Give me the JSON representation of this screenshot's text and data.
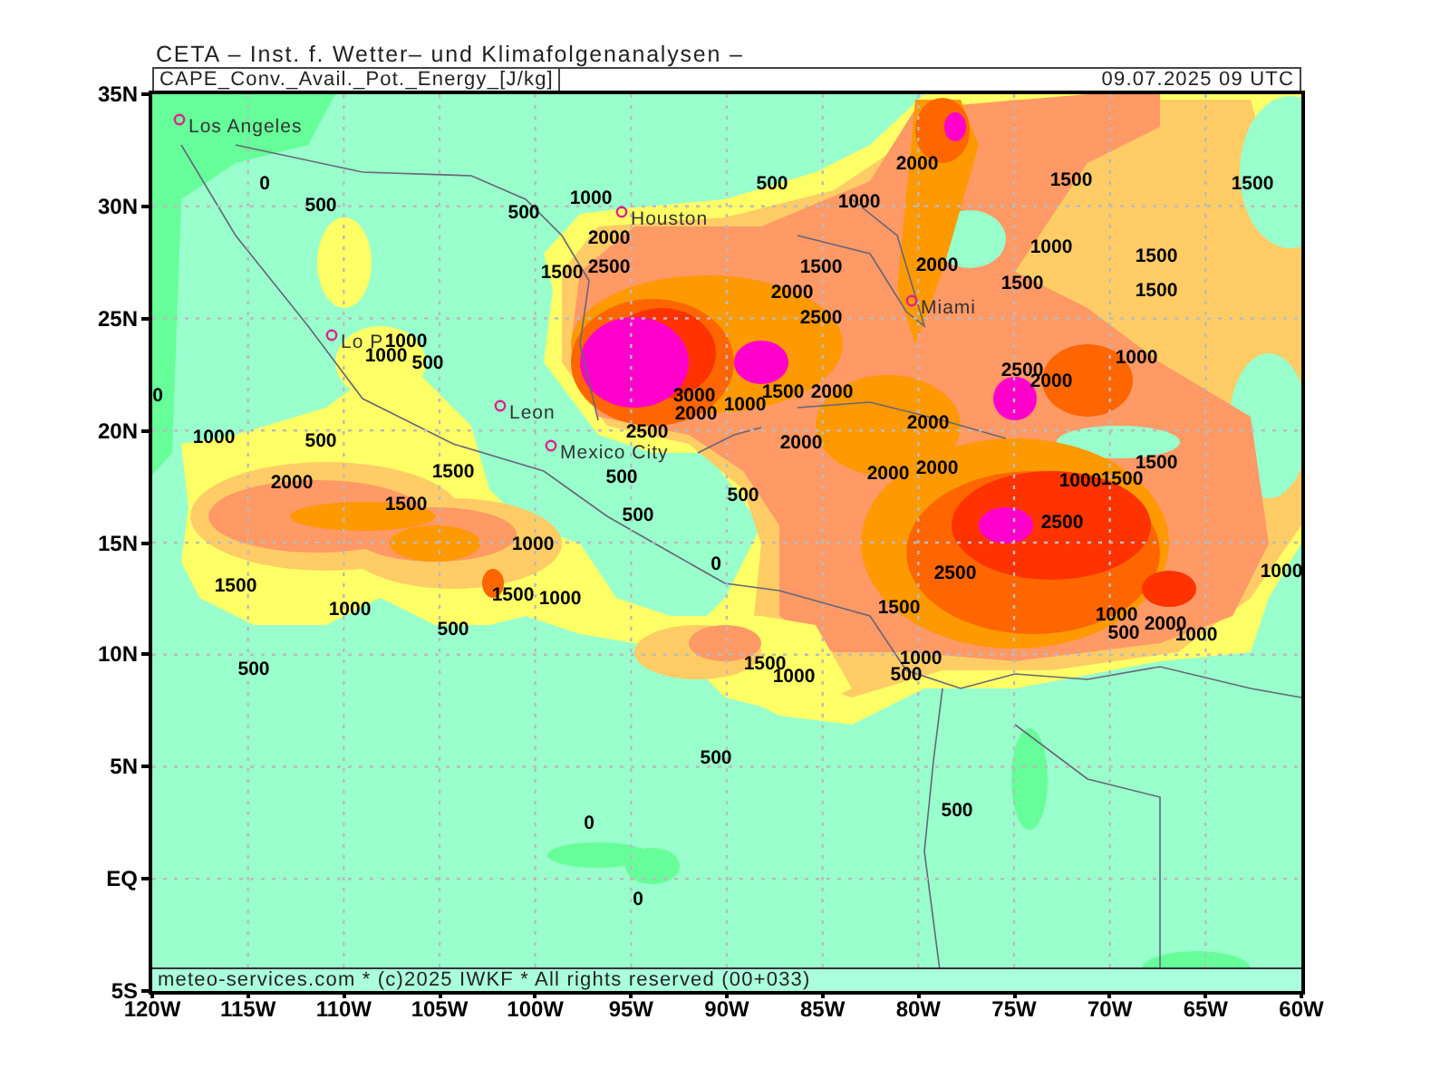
{
  "header": {
    "institute": "CETA – Inst. f. Wetter– und Klimafolgenanalysen –",
    "variable": "CAPE_Conv._Avail._Pot._Energy_[J/kg]",
    "valid_time": "09.07.2025 09 UTC"
  },
  "map": {
    "cities": [
      "Los Angeles",
      "Houston",
      "Miami",
      "Lo P",
      "Leon",
      "Mexico City"
    ],
    "contour_labels": [
      "0",
      "500",
      "1000",
      "500",
      "500",
      "1000",
      "2000",
      "1500",
      "1500",
      "2000",
      "1500",
      "2500",
      "1000",
      "1500",
      "1500",
      "2000",
      "2000",
      "1500",
      "1500",
      "2500",
      "1000",
      "1000",
      "500",
      "1000",
      "0",
      "3000",
      "2000",
      "2500",
      "500",
      "1000",
      "1500",
      "2000",
      "2500",
      "2000",
      "2000",
      "2000",
      "2000",
      "2000",
      "1000",
      "1500",
      "1500",
      "500",
      "1000",
      "500",
      "2000",
      "1500",
      "1500",
      "500",
      "2500",
      "1000",
      "1500",
      "1500",
      "1000",
      "1000",
      "500",
      "0",
      "2500",
      "1500",
      "1000",
      "1000",
      "500",
      "2000",
      "1000",
      "1500",
      "1000",
      "500",
      "1000",
      "500",
      "500",
      "500",
      "0",
      "0"
    ],
    "credit": "meteo-services.com * (c)2025 IWKF * All rights reserved (00+033)"
  },
  "lat_ticks": [
    "35N",
    "30N",
    "25N",
    "20N",
    "15N",
    "10N",
    "5N",
    "EQ",
    "5S"
  ],
  "lon_ticks": [
    "120W",
    "115W",
    "110W",
    "105W",
    "100W",
    "95W",
    "90W",
    "85W",
    "80W",
    "75W",
    "70W",
    "65W",
    "60W"
  ]
}
